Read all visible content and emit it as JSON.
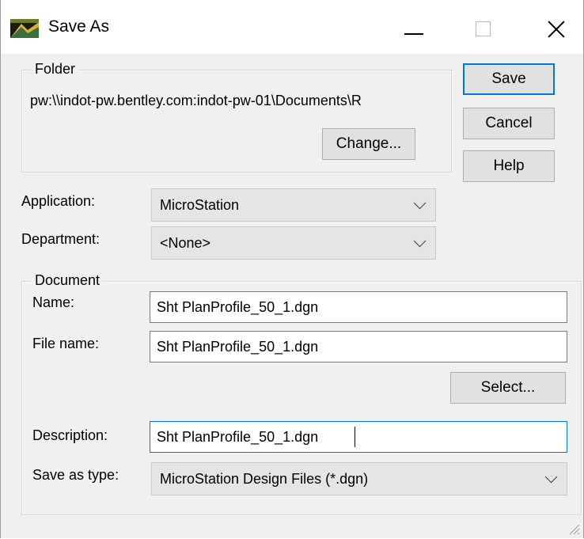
{
  "window": {
    "title": "Save As"
  },
  "folder": {
    "group_label": "Folder",
    "path": "pw:\\\\indot-pw.bentley.com:indot-pw-01\\Documents\\R",
    "change_label": "Change..."
  },
  "buttons": {
    "save_label": "Save",
    "cancel_label": "Cancel",
    "help_label": "Help"
  },
  "application": {
    "label": "Application:",
    "value": "MicroStation"
  },
  "department": {
    "label": "Department:",
    "value": "<None>"
  },
  "document": {
    "group_label": "Document",
    "name_label": "Name:",
    "name_value": "Sht PlanProfile_50_1.dgn",
    "file_name_label": "File name:",
    "file_name_value": "Sht PlanProfile_50_1.dgn",
    "select_label": "Select...",
    "description_label": "Description:",
    "description_value": "Sht PlanProfile_50_1.dgn",
    "save_as_type_label": "Save as type:",
    "save_as_type_value": "MicroStation Design Files (*.dgn)"
  },
  "colors": {
    "focus_accent": "#0078d7",
    "dialog_background": "#f0f0f0"
  }
}
